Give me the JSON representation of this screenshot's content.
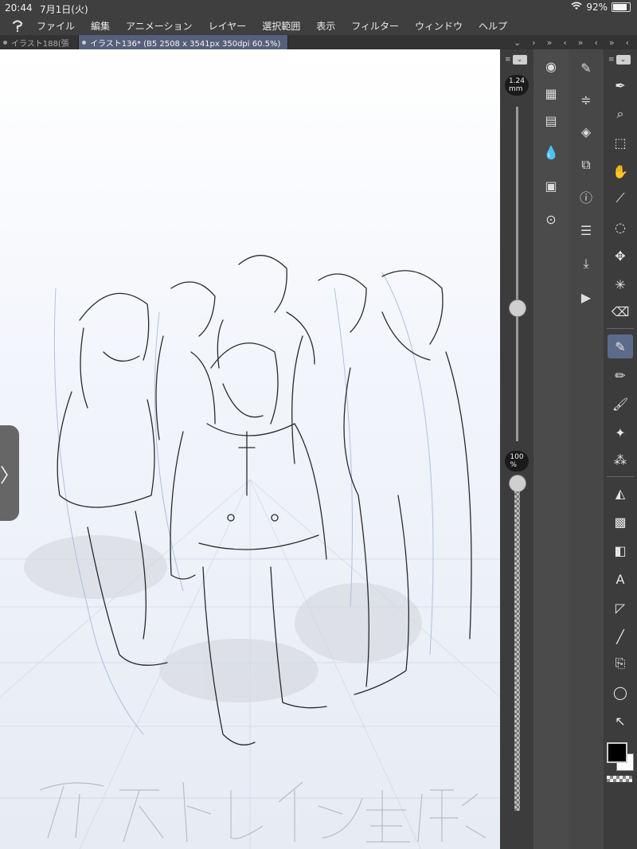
{
  "status": {
    "time": "20:44",
    "date": "7月1日(火)",
    "battery": "92%",
    "battery_level": 0.92
  },
  "menu": {
    "items": [
      "ファイル",
      "編集",
      "アニメーション",
      "レイヤー",
      "選択範囲",
      "表示",
      "フィルター",
      "ウィンドウ",
      "ヘルプ"
    ]
  },
  "tabs": [
    {
      "label": "イラスト188(張",
      "active": false
    },
    {
      "label": "イラスト136* (B5 2508 x 3541px 350dpi 60.5%)",
      "active": true
    }
  ],
  "canvas": {
    "artwork_title": "アストレイン生徒会"
  },
  "brush_size": {
    "label": "1.24\nmm",
    "value_mm": 1.24
  },
  "brush_opacity": {
    "label": "100\n%",
    "value_percent": 100
  },
  "icons": {
    "panel_col1": [
      "navigator-icon",
      "sub-view-icon",
      "timeline-icon",
      "color-set-icon",
      "material-icon",
      "auto-action-icon"
    ],
    "panel_col2": [
      "tool-property-icon",
      "layer-property-icon",
      "layer-icon",
      "layer-search-icon",
      "item-bank-icon",
      "history-icon",
      "export-icon",
      "animation-cel-icon"
    ],
    "tools": [
      "pen-icon",
      "zoom-icon",
      "move-object-icon",
      "hand-icon",
      "eyedropper-icon",
      "lasso-select-icon",
      "move-icon",
      "auto-select-icon",
      "eraser-icon",
      "pen-tool-icon",
      "pencil-icon",
      "brush-icon",
      "sparkle-decoration-icon",
      "airbrush-icon",
      "fill-icon",
      "material-stamp-icon",
      "gradient-icon",
      "text-icon",
      "figure-icon",
      "line-icon",
      "ruler-icon",
      "balloon-icon",
      "correct-line-icon"
    ]
  },
  "colors": {
    "main_color": "#000000",
    "sub_color": "#ffffff",
    "accent": "#5c6b8a"
  }
}
